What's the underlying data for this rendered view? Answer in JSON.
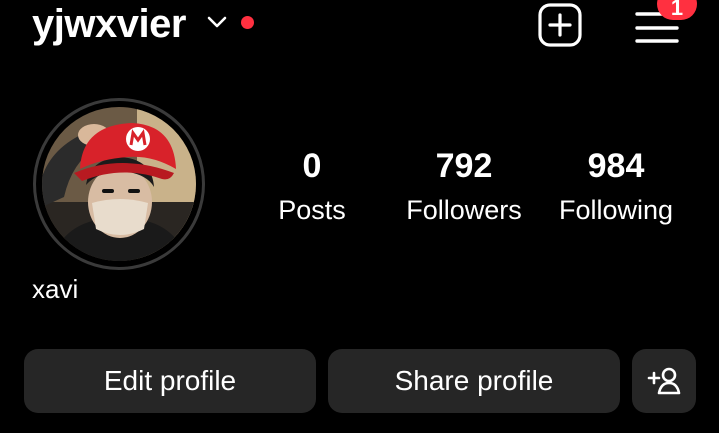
{
  "header": {
    "username": "yjwxvier",
    "chevron_icon": "chevron-down-icon",
    "status_dot_color": "#ff3040",
    "add_icon": "plus-square-icon",
    "menu_icon": "hamburger-menu-icon",
    "notification_count": "1",
    "badge_color": "#ff3040"
  },
  "profile": {
    "display_name": "xavi",
    "avatar_description_icon": "profile-photo"
  },
  "stats": [
    {
      "count": "0",
      "label": "Posts"
    },
    {
      "count": "792",
      "label": "Followers"
    },
    {
      "count": "984",
      "label": "Following"
    }
  ],
  "actions": {
    "edit_label": "Edit profile",
    "share_label": "Share profile",
    "add_person_icon": "add-person-icon"
  },
  "colors": {
    "background": "#000000",
    "button_bg": "#262626",
    "text": "#ffffff"
  }
}
